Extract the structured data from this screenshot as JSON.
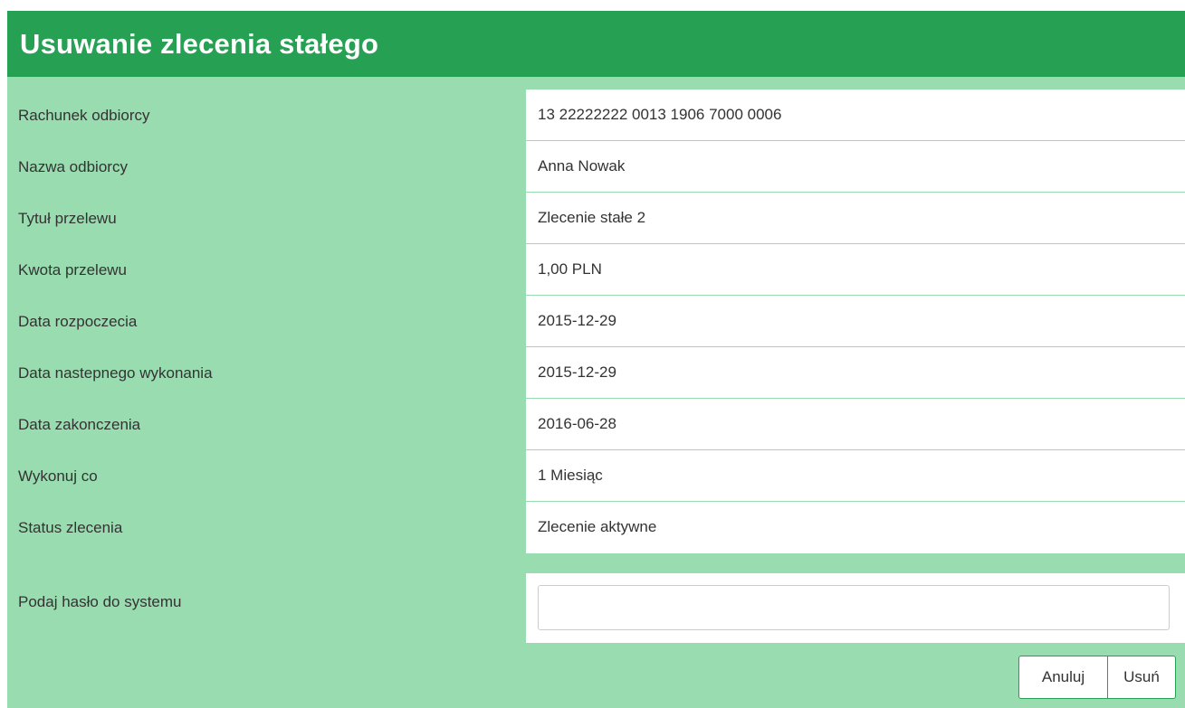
{
  "header": {
    "title": "Usuwanie zlecenia stałego"
  },
  "details": [
    {
      "label": "Rachunek odbiorcy",
      "value": "13 22222222 0013 1906 7000 0006"
    },
    {
      "label": "Nazwa odbiorcy",
      "value": "Anna Nowak"
    },
    {
      "label": "Tytuł przelewu",
      "value": "Zlecenie stałe 2"
    },
    {
      "label": "Kwota przelewu",
      "value": "1,00 PLN"
    },
    {
      "label": "Data rozpoczecia",
      "value": "2015-12-29"
    },
    {
      "label": "Data nastepnego wykonania",
      "value": "2015-12-29"
    },
    {
      "label": "Data zakonczenia",
      "value": "2016-06-28"
    },
    {
      "label": "Wykonuj co",
      "value": "1 Miesiąc"
    },
    {
      "label": "Status zlecenia",
      "value": "Zlecenie aktywne"
    }
  ],
  "password": {
    "label": "Podaj hasło do systemu",
    "value": "",
    "placeholder": ""
  },
  "actions": {
    "cancel_label": "Anuluj",
    "delete_label": "Usuń"
  },
  "colors": {
    "header_bg": "#26a052",
    "panel_bg": "#99dcaf",
    "value_bg": "#ffffff"
  }
}
